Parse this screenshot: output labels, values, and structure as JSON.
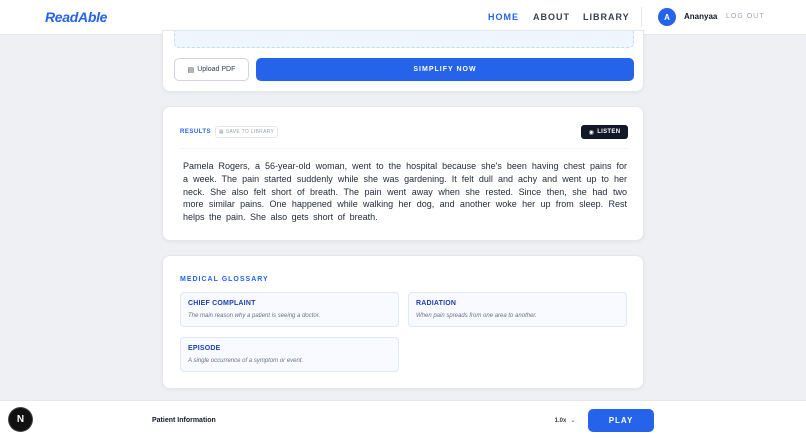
{
  "header": {
    "logo": "ReadAble",
    "nav": [
      {
        "label": "HOME",
        "active": true
      },
      {
        "label": "ABOUT",
        "active": false
      },
      {
        "label": "LIBRARY",
        "active": false
      }
    ],
    "user": {
      "initial": "A",
      "name": "Ananyaa"
    },
    "logout_label": "LOG OUT"
  },
  "input_card": {
    "upload_label": "Upload PDF",
    "simplify_label": "SIMPLIFY NOW"
  },
  "results": {
    "label": "RESULTS",
    "save_label": "SAVE TO LIBRARY",
    "listen_label": "LISTEN",
    "text": "Pamela Rogers, a 56-year-old woman, went to the hospital because she's been having chest pains for a week. The pain started suddenly while she was gardening. It felt dull and achy and went up to her neck. She also felt short of breath. The pain went away when she rested. Since then, she had two more similar pains. One happened while walking her dog, and another woke her up from sleep. Rest helps the pain. She also gets short of breath."
  },
  "glossary": {
    "title": "MEDICAL GLOSSARY",
    "terms": [
      {
        "term": "CHIEF COMPLAINT",
        "definition": "The main reason why a patient is seeing a doctor."
      },
      {
        "term": "RADIATION",
        "definition": "When pain spreads from one area to another."
      },
      {
        "term": "EPISODE",
        "definition": "A single occurrence of a symptom or event."
      }
    ]
  },
  "player": {
    "badge": "N",
    "title": "Patient Information",
    "speed": "1.0x",
    "play_label": "PLAY"
  },
  "colors": {
    "accent": "#2563eb",
    "dark": "#111827",
    "background": "#eef0f4"
  }
}
